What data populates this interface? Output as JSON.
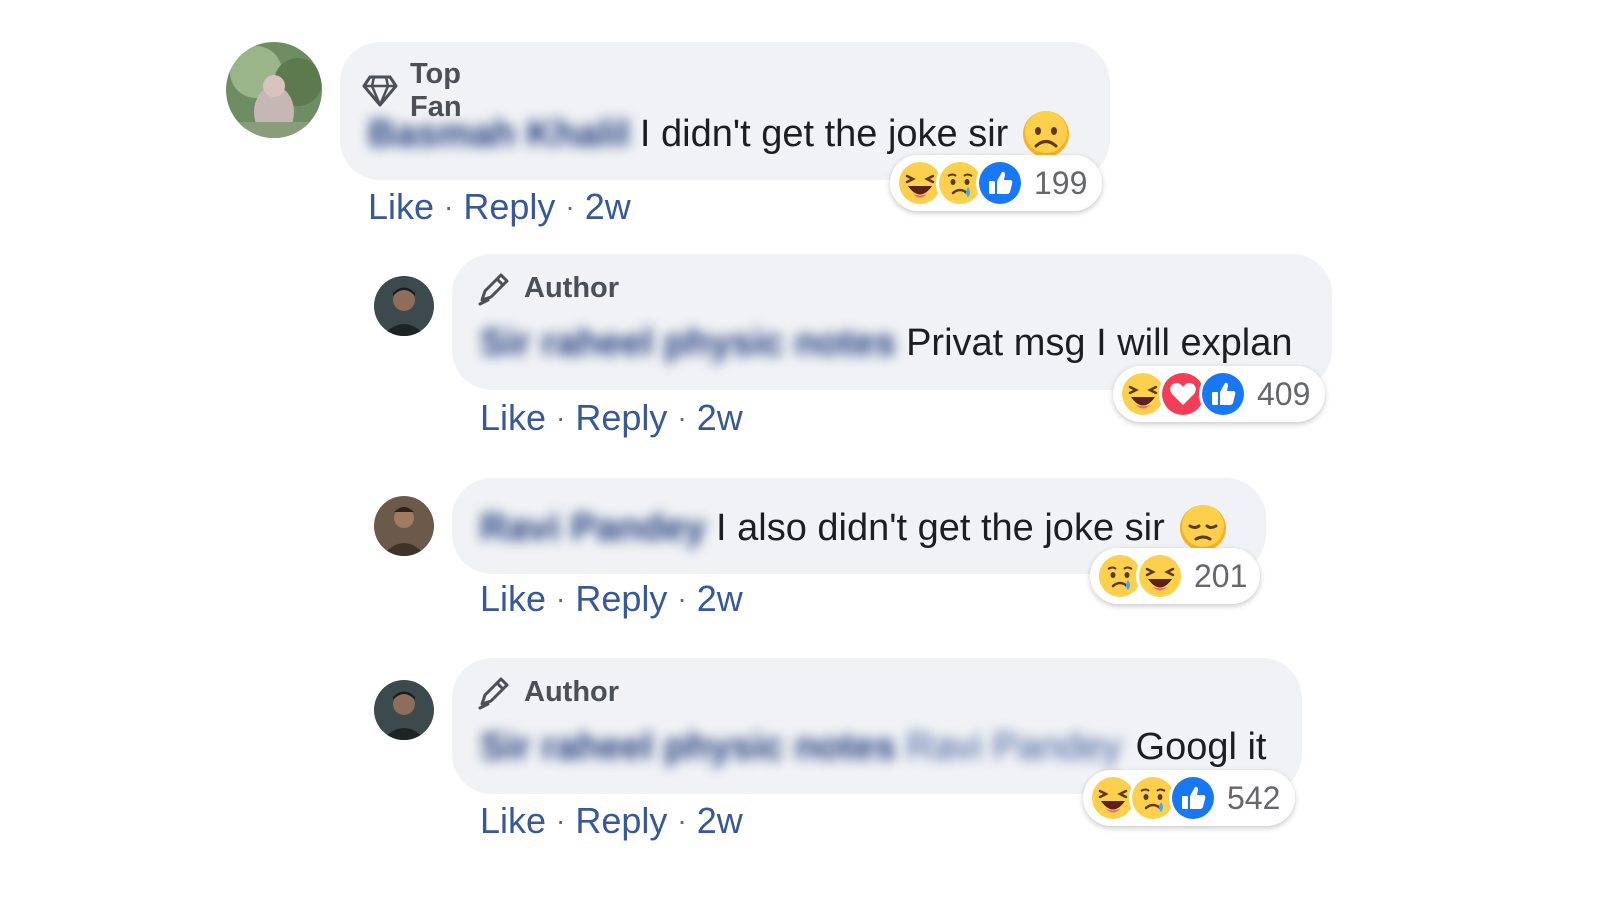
{
  "comments": [
    {
      "badge": "Top Fan",
      "badge_icon": "diamond-icon",
      "author": "Basmah Khalil",
      "tagged": "",
      "text": "I didn't get the joke sir",
      "text_emoji": "frowning-face-emoji",
      "reactions": [
        "haha",
        "sad",
        "like"
      ],
      "reaction_count": "199",
      "like_label": "Like",
      "reply_label": "Reply",
      "time": "2w"
    },
    {
      "badge": "Author",
      "badge_icon": "pencil-icon",
      "author": "Sir raheel physic notes",
      "tagged": "",
      "text": "Privat msg I will explan",
      "text_emoji": "",
      "reactions": [
        "haha",
        "love",
        "like"
      ],
      "reaction_count": "409",
      "like_label": "Like",
      "reply_label": "Reply",
      "time": "2w"
    },
    {
      "badge": "",
      "badge_icon": "",
      "author": "Ravi Pandey",
      "tagged": "",
      "text": "I also didn't get the joke sir",
      "text_emoji": "pensive-face-emoji",
      "reactions": [
        "sad",
        "haha"
      ],
      "reaction_count": "201",
      "like_label": "Like",
      "reply_label": "Reply",
      "time": "2w"
    },
    {
      "badge": "Author",
      "badge_icon": "pencil-icon",
      "author": "Sir raheel physic notes",
      "tagged": "Ravi Pandey",
      "text": "Googl it",
      "text_emoji": "",
      "reactions": [
        "haha",
        "sad",
        "like"
      ],
      "reaction_count": "542",
      "like_label": "Like",
      "reply_label": "Reply",
      "time": "2w"
    }
  ],
  "colors": {
    "bubble": "#f0f2f5",
    "link": "#385898",
    "like_blue": "#1877f2",
    "love_red": "#f33e58",
    "emoji_yellow": "#f7b125"
  }
}
